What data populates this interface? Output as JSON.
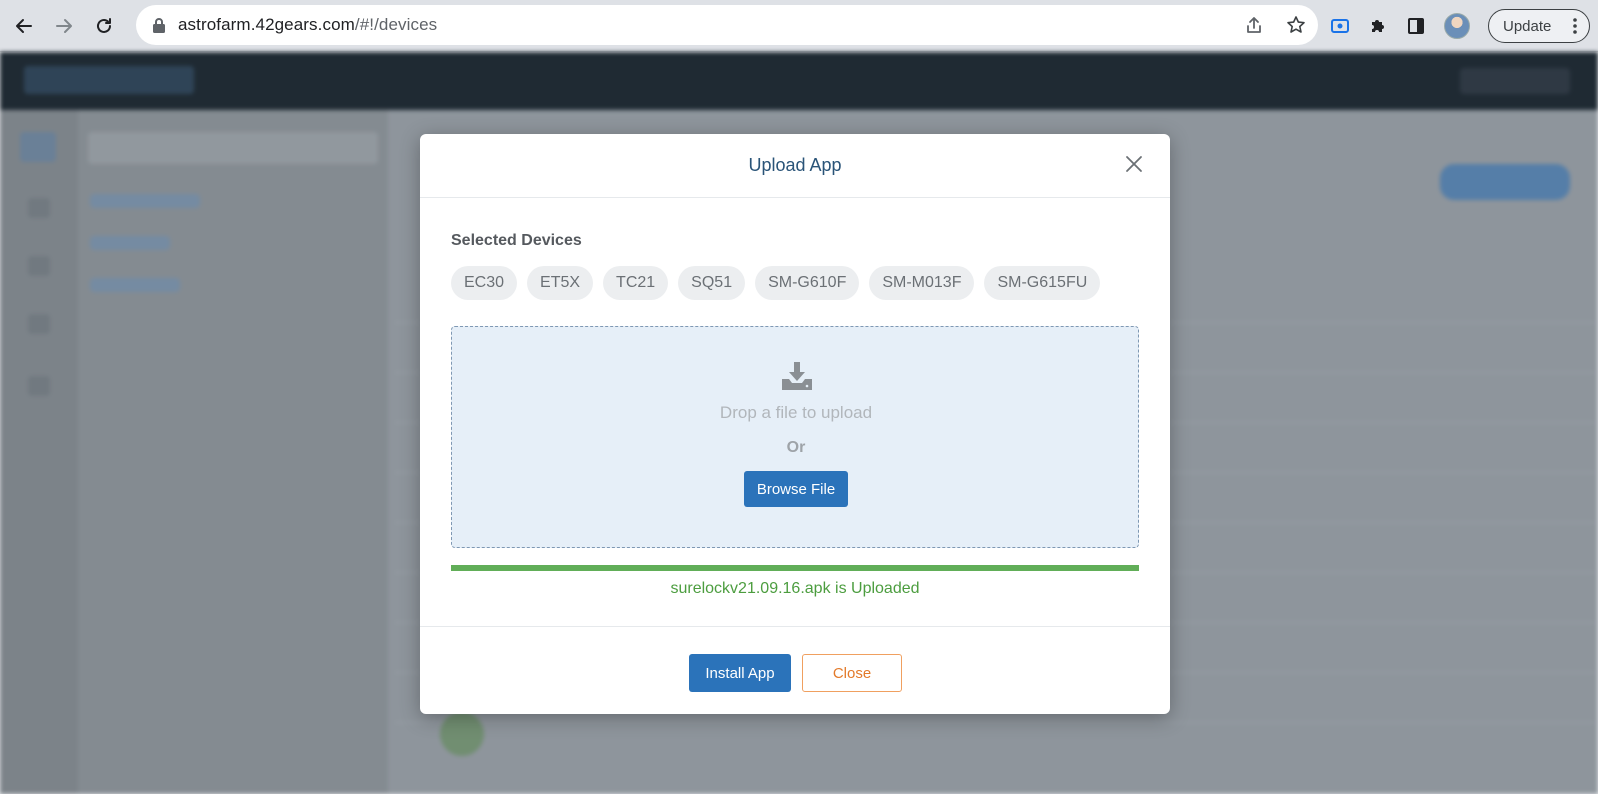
{
  "browser": {
    "url_host": "astrofarm.42gears.com",
    "url_path": "/#!/devices",
    "update_label": "Update"
  },
  "modal": {
    "title": "Upload App",
    "selected_devices_label": "Selected Devices",
    "devices": [
      "EC30",
      "ET5X",
      "TC21",
      "SQ51",
      "SM-G610F",
      "SM-M013F",
      "SM-G615FU"
    ],
    "dropzone_text": "Drop a file to upload",
    "or_text": "Or",
    "browse_label": "Browse File",
    "upload_progress": 1.0,
    "status_text": "surelockv21.09.16.apk is Uploaded",
    "install_label": "Install App",
    "close_label": "Close"
  },
  "colors": {
    "primary": "#2b73ba",
    "success": "#61ae58",
    "success_text": "#4c9d3f",
    "close_outline": "#e37a2a",
    "title": "#2a5478"
  },
  "icons": {
    "back": "arrow-left-icon",
    "forward": "arrow-right-icon",
    "reload": "reload-icon",
    "lock": "lock-icon",
    "share": "share-icon",
    "star": "star-icon",
    "extension": "puzzle-icon",
    "screen": "screen-capture-icon",
    "sidepanel": "side-panel-icon",
    "close": "close-icon",
    "download": "download-icon"
  }
}
